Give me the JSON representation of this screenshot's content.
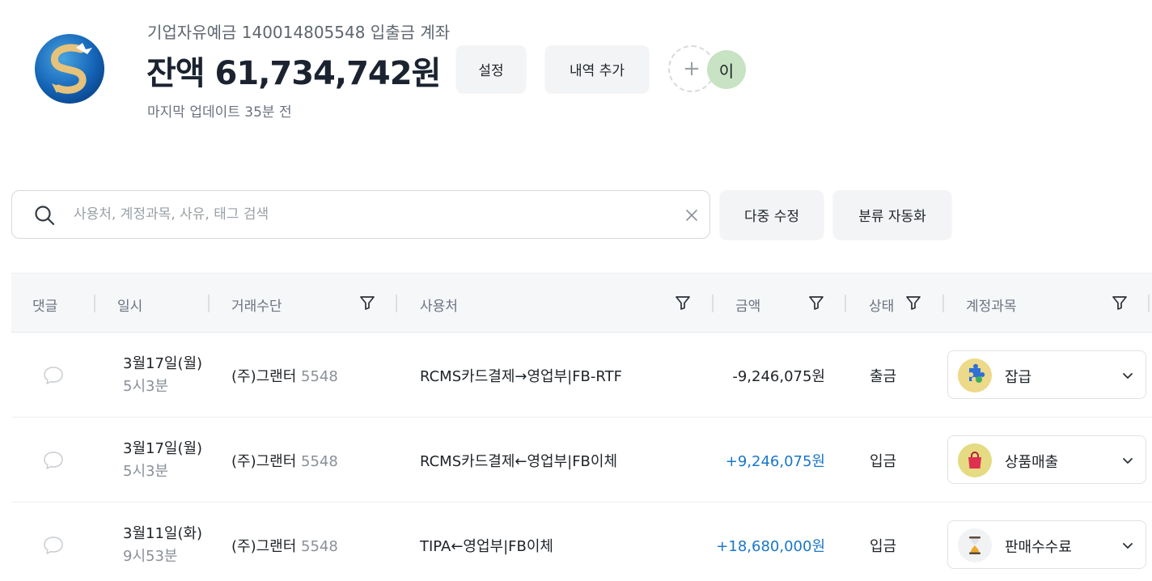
{
  "header": {
    "account_name": "기업자유예금 140014805548 입출금 계좌",
    "balance": "잔액 61,734,742원",
    "updated": "마지막 업데이트 35분 전",
    "settings_label": "설정",
    "add_entry_label": "내역 추가",
    "add_member_symbol": "+",
    "avatar_initial": "이"
  },
  "search": {
    "placeholder": "사용처, 계정과목, 사유, 태그 검색",
    "value": "",
    "bulk_edit_label": "다중 수정",
    "auto_classify_label": "분류 자동화"
  },
  "table": {
    "columns": {
      "comment": "댓글",
      "datetime": "일시",
      "method": "거래수단",
      "merchant": "사용처",
      "amount": "금액",
      "status": "상태",
      "category": "계정과목"
    },
    "rows": [
      {
        "date": "3월17일(월)",
        "time": "5시3분",
        "method_name": "(주)그랜터",
        "method_acct": "5548",
        "merchant": "RCMS카드결제→영업부|FB-RTF",
        "amount": "-9,246,075원",
        "direction": "out",
        "status": "출금",
        "category": "잡급",
        "category_icon": "puzzle-icon"
      },
      {
        "date": "3월17일(월)",
        "time": "5시3분",
        "method_name": "(주)그랜터",
        "method_acct": "5548",
        "merchant": "RCMS카드결제←영업부|FB이체",
        "amount": "+9,246,075원",
        "direction": "in",
        "status": "입금",
        "category": "상품매출",
        "category_icon": "shopping-bag-icon"
      },
      {
        "date": "3월11일(화)",
        "time": "9시53분",
        "method_name": "(주)그랜터",
        "method_acct": "5548",
        "merchant": "TIPA←영업부|FB이체",
        "amount": "+18,680,000원",
        "direction": "in",
        "status": "입금",
        "category": "판매수수료",
        "category_icon": "hourglass-icon"
      }
    ]
  },
  "colors": {
    "income": "#1976c9",
    "avatar": "#c7e3c3",
    "button_bg": "#f3f4f6"
  }
}
